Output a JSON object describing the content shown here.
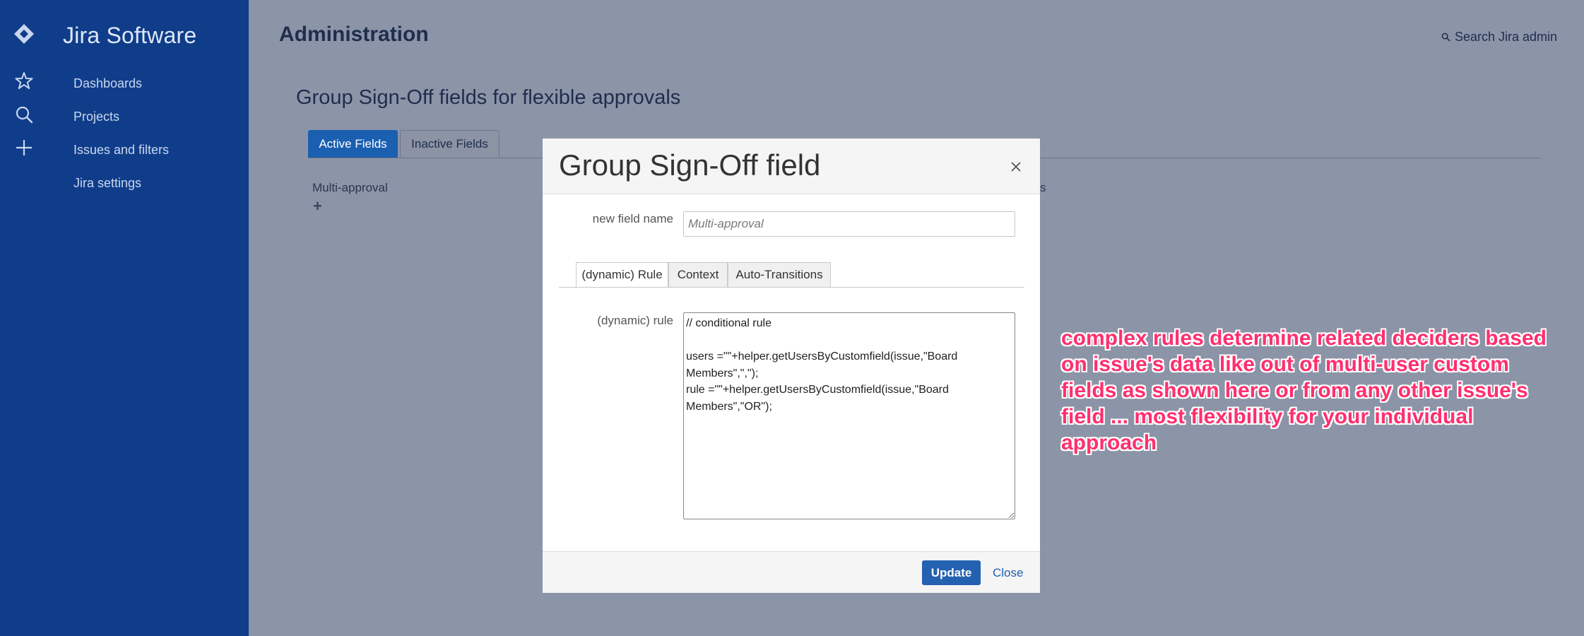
{
  "sidebar": {
    "brand": "Jira Software",
    "nav_icons": [
      "star-icon",
      "search-icon",
      "plus-icon"
    ],
    "items": [
      {
        "label": "Dashboards"
      },
      {
        "label": "Projects"
      },
      {
        "label": "Issues and filters"
      },
      {
        "label": "Jira settings"
      }
    ]
  },
  "header": {
    "title": "Administration",
    "search_label": "Search Jira admin"
  },
  "main": {
    "section_title": "Group Sign-Off fields for flexible approvals",
    "tabs": [
      {
        "label": "Active Fields",
        "active": true
      },
      {
        "label": "Inactive Fields",
        "active": false
      }
    ],
    "column_label": "Multi-approval",
    "add_symbol": "+",
    "partial_text": "s"
  },
  "dialog": {
    "title": "Group Sign-Off field",
    "name_label": "new field name",
    "name_placeholder": "Multi-approval",
    "tabs": [
      {
        "label": "(dynamic) Rule",
        "active": true
      },
      {
        "label": "Context",
        "active": false
      },
      {
        "label": "Auto-Transitions",
        "active": false
      }
    ],
    "rule_label": "(dynamic) rule",
    "rule_text": "// conditional rule\n\nusers =\"\"+helper.getUsersByCustomfield(issue,\"Board Members\",\",\");\nrule =\"\"+helper.getUsersByCustomfield(issue,\"Board Members\",\"OR\");",
    "update_label": "Update",
    "close_label": "Close"
  },
  "annotation": "complex rules determine related deciders based on issue's data like out of multi-user custom fields as shown here or from any other issue's field ... most flexibility for your individual approach",
  "colors": {
    "sidebar": "#0f3d8a",
    "overlay": "#8c94a7",
    "primary_button": "#2461b0",
    "annotation": "#ff2f6e"
  }
}
